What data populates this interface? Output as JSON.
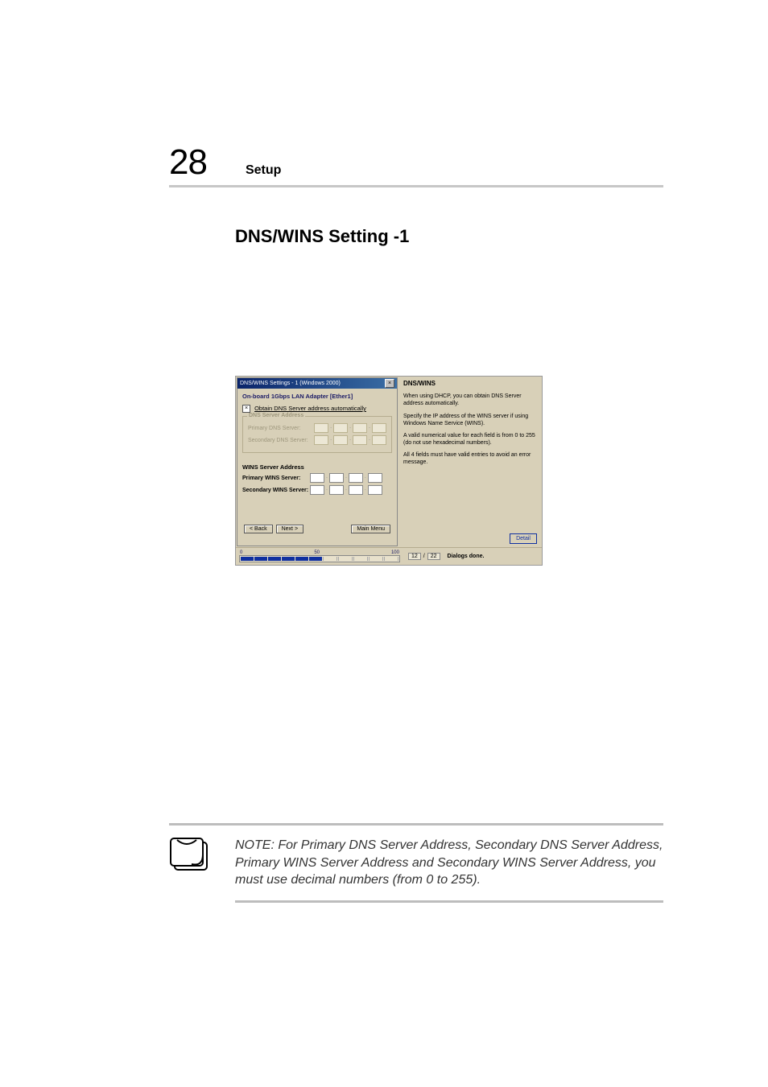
{
  "page": {
    "number": "28",
    "header_label": "Setup",
    "section_title": "DNS/WINS Setting -1"
  },
  "dialog": {
    "titlebar": "DNS/WINS Settings - 1 (Windows 2000)",
    "adapter_line": "On-board 1Gbps LAN Adapter [Ether1]",
    "obtain_label": "Obtain DNS Server address automatically",
    "dns_group_legend": "DNS Server Address",
    "primary_dns_label": "Primary DNS Server:",
    "secondary_dns_label": "Secondary DNS Server:",
    "wins_group_legend": "WINS Server Address",
    "primary_wins_label": "Primary WINS Server:",
    "secondary_wins_label": "Secondary WINS Server:",
    "back_btn": "< Back",
    "next_btn": "Next >",
    "main_menu_btn": "Main Menu"
  },
  "help": {
    "title": "DNS/WINS",
    "p1": "When using DHCP, you can obtain DNS Server address automatically.",
    "p2": "Specify the IP address of the WINS server if using Windows Name Service (WINS).",
    "p3": "A valid numerical value for each field is from 0 to 255 (do not use hexadecimal numbers).",
    "p4": "All 4 fields must have valid entries to avoid an error message.",
    "detail_btn": "Detail"
  },
  "progress": {
    "tick0": "0",
    "tick50": "50",
    "tick100": "100",
    "current": "12",
    "sep": "/",
    "total": "22",
    "status": "Dialogs done."
  },
  "note": {
    "text": "NOTE: For Primary DNS Server Address, Secondary DNS Server Address, Primary WINS Server Address and Secondary WINS  Server Address, you must use decimal numbers (from 0 to 255)."
  }
}
